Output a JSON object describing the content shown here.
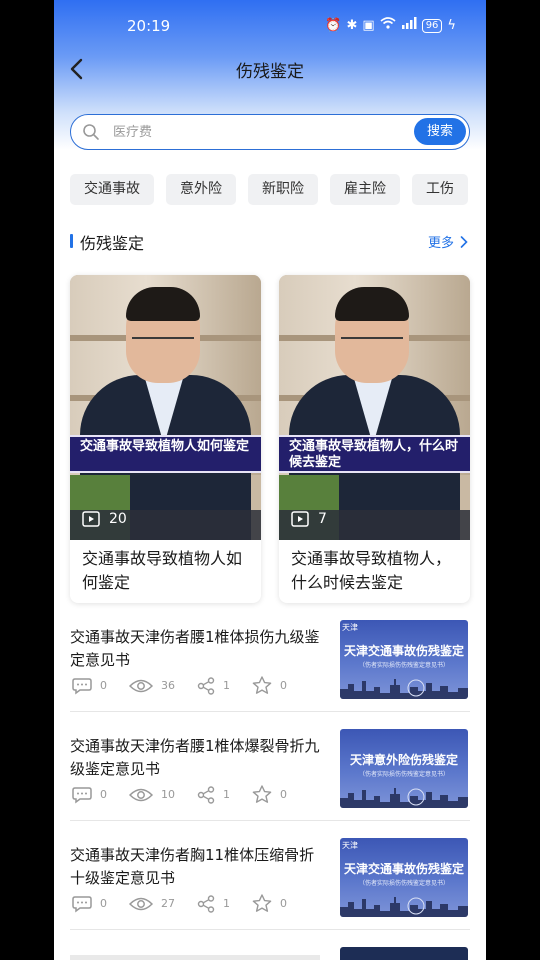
{
  "status_bar": {
    "time": "20:19",
    "battery": "96"
  },
  "nav": {
    "title": "伤残鉴定"
  },
  "search": {
    "placeholder": "医疗费",
    "button_label": "搜索"
  },
  "categories": [
    "交通事故",
    "意外险",
    "新职险",
    "雇主险",
    "工伤"
  ],
  "section": {
    "title": "伤残鉴定",
    "more_label": "更多"
  },
  "videos": [
    {
      "caption": "交通事故导致植物人如何鉴定",
      "play_count": "20",
      "title": "交通事故导致植物人如何鉴定"
    },
    {
      "caption": "交通事故导致植物人，什么时候去鉴定",
      "play_count": "7",
      "title": "交通事故导致植物人，什么时候去鉴定"
    }
  ],
  "articles": [
    {
      "title": "交通事故天津伤者腰1椎体损伤九级鉴定意见书",
      "comments": "0",
      "views": "36",
      "shares": "1",
      "stars": "0",
      "thumb_tag": "天津",
      "thumb_title": "天津交通事故伤残鉴定",
      "thumb_sub": "（伤者实际损伤伤残鉴定意见书）"
    },
    {
      "title": "交通事故天津伤者腰1椎体爆裂骨折九级鉴定意见书",
      "comments": "0",
      "views": "10",
      "shares": "1",
      "stars": "0",
      "thumb_tag": "",
      "thumb_title": "天津意外险伤残鉴定",
      "thumb_sub": "（伤者实际损伤伤残鉴定意见书）"
    },
    {
      "title": "交通事故天津伤者胸11椎体压缩骨折十级鉴定意见书",
      "comments": "0",
      "views": "27",
      "shares": "1",
      "stars": "0",
      "thumb_tag": "天津",
      "thumb_title": "天津交通事故伤残鉴定",
      "thumb_sub": "（伤者实际损伤伤残鉴定意见书）"
    }
  ],
  "colors": {
    "accent": "#2272e6",
    "header_gradient_top": "#2f6ff2",
    "caption_band": "#231f6b"
  }
}
